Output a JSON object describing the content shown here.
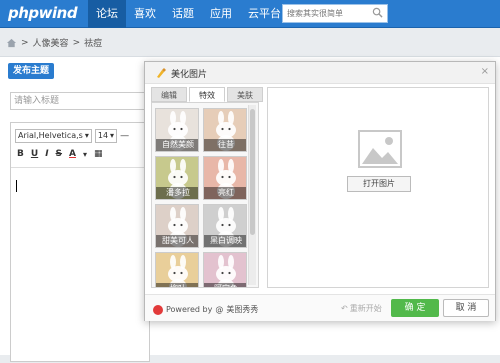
{
  "brand": {
    "logo": "phpwind",
    "accent": "#2a7ccf"
  },
  "nav": {
    "items": [
      "论坛",
      "喜欢",
      "话题",
      "应用",
      "云平台"
    ],
    "active_index": 0
  },
  "search": {
    "placeholder": "搜索其实很简单"
  },
  "breadcrumb": {
    "items": [
      "人像美容",
      "祛痘"
    ],
    "separator": ">"
  },
  "toolbar": {
    "publish_label": "发布主题"
  },
  "post": {
    "title_placeholder": "请输入标题"
  },
  "editor": {
    "font_family": "Arial,Helvetica,s",
    "font_size": "14",
    "format_buttons": [
      "B",
      "U",
      "I",
      "S",
      "A"
    ]
  },
  "dialog": {
    "title": "美化图片",
    "close_glyph": "×",
    "tabs": [
      "编辑",
      "特效",
      "美肤"
    ],
    "active_tab": 1,
    "effects": [
      {
        "label": "自然美颜",
        "tint": "#e8e2dc"
      },
      {
        "label": "往昔",
        "tint": "#e6cdb8"
      },
      {
        "label": "潘多拉",
        "tint": "#c7c98d"
      },
      {
        "label": "亮红",
        "tint": "#e8b7a8"
      },
      {
        "label": "甜美可人",
        "tint": "#ddd0c8"
      },
      {
        "label": "黑白调映",
        "tint": "#cfcfcf"
      },
      {
        "label": "柳叶",
        "tint": "#e9cf9a"
      },
      {
        "label": "阿宝色",
        "tint": "#e3c2cf"
      }
    ],
    "open_image_label": "打开图片",
    "powered_by": "Powered by",
    "powered_brand": "美图秀秀",
    "reset_label": "重新开始",
    "ok_label": "确 定",
    "cancel_label": "取 消",
    "ok_color": "#52b94b"
  }
}
